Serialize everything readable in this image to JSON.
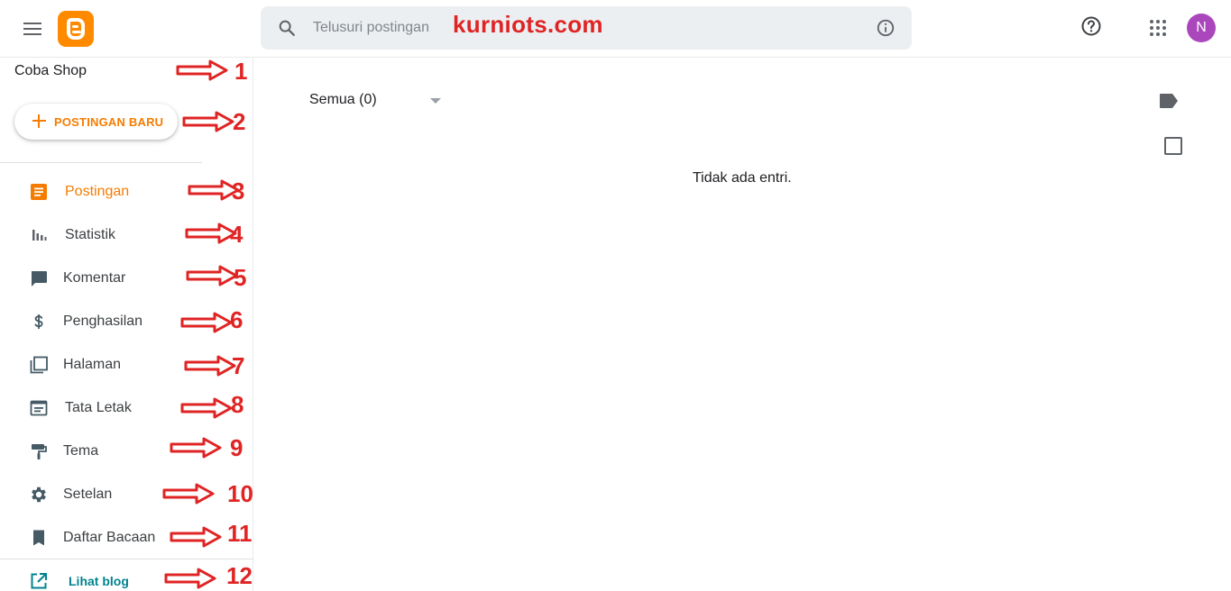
{
  "header": {
    "search_placeholder": "Telusuri postingan",
    "watermark": "kurniots.com",
    "avatar_letter": "N",
    "avatar_color": "#ab47bc",
    "brand_color": "#ff8a00"
  },
  "sidebar": {
    "blog_name": "Coba Shop",
    "new_post_label": "POSTINGAN BARU",
    "items": [
      {
        "label": "Postingan",
        "icon": "posts-icon",
        "active": true
      },
      {
        "label": "Statistik",
        "icon": "stats-icon"
      },
      {
        "label": "Komentar",
        "icon": "comment-icon"
      },
      {
        "label": "Penghasilan",
        "icon": "dollar-icon"
      },
      {
        "label": "Halaman",
        "icon": "pages-icon"
      },
      {
        "label": "Tata Letak",
        "icon": "layout-icon"
      },
      {
        "label": "Tema",
        "icon": "paint-roller-icon"
      },
      {
        "label": "Setelan",
        "icon": "gear-icon"
      },
      {
        "label": "Daftar Bacaan",
        "icon": "bookmark-icon"
      }
    ],
    "view_blog_label": "Lihat blog"
  },
  "annotations": [
    "1",
    "2",
    "3",
    "4",
    "5",
    "6",
    "7",
    "8",
    "9",
    "10",
    "11",
    "12"
  ],
  "main": {
    "filter_label": "Semua (0)",
    "empty_message": "Tidak ada entri."
  }
}
